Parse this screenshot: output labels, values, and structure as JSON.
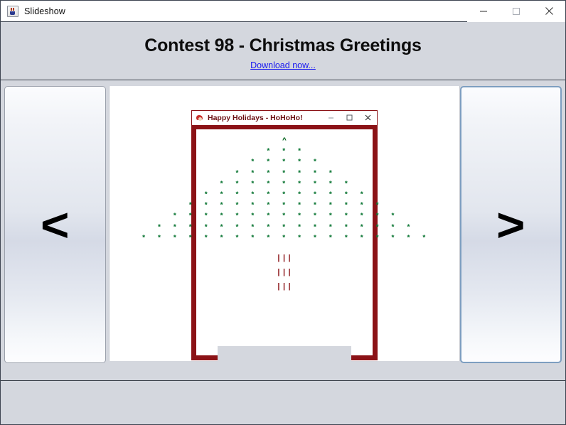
{
  "window": {
    "title": "Slideshow",
    "icon": "java-coffee-cup-icon",
    "controls": {
      "minimize": "minimize-icon",
      "maximize": "maximize-icon",
      "close": "close-icon"
    }
  },
  "header": {
    "title": "Contest 98 - Christmas Greetings",
    "link": "Download now...",
    "link_color": "#1a1af0"
  },
  "navigation": {
    "prev_label": "<",
    "next_label": ">",
    "next_focused": true
  },
  "slide": {
    "greeting_window": {
      "title": "Happy Holidays - HoHoHo!",
      "icon": "santa-icon",
      "border_color": "#8b1216",
      "controls": {
        "minimize": "minimize-icon",
        "maximize": "maximize-icon",
        "close": "close-icon"
      },
      "art": {
        "star_color": "#15803d",
        "trunk_color": "#8b1216",
        "apex": "^",
        "rows": [
          "*  *  *",
          "*  *  *  *  *",
          "*  *  *  *  *  *  *",
          "*  *  *  *  *  *  *  *  *",
          "*  *  *  *  *  *  *  *  *  *  *",
          "*  *  *  *  *  *  *  *  *  *  *  *  *",
          "*  *  *  *  *  *  *  *  *  *  *  *  *  *  *",
          "*  *  *  *  *  *  *  *  *  *  *  *  *  *  *  *  *",
          "*  *  *  *  *  *  *  *  *  *  *  *  *  *  *  *  *  *  *"
        ],
        "trunk": [
          "|||",
          "|||",
          "|||"
        ]
      }
    }
  }
}
